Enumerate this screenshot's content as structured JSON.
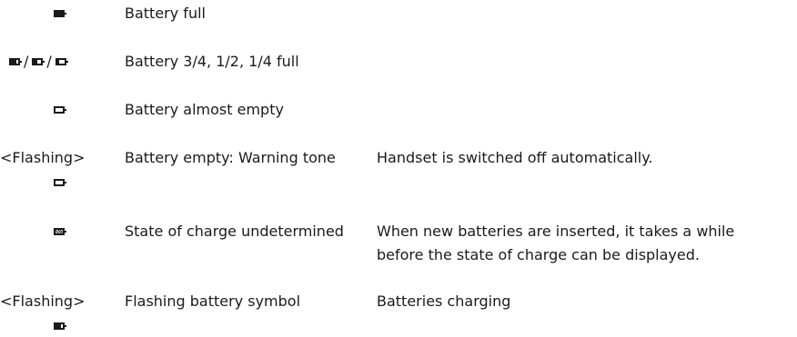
{
  "flashing_label": "<Flashing>",
  "separator": "/",
  "rows": [
    {
      "icons": [
        {
          "name": "battery-full-icon",
          "level": 1.0
        }
      ],
      "description": "Battery full",
      "note": ""
    },
    {
      "icons": [
        {
          "name": "battery-three-quarter-icon",
          "level": 0.75
        },
        {
          "name": "battery-half-icon",
          "level": 0.5
        },
        {
          "name": "battery-quarter-icon",
          "level": 0.25
        }
      ],
      "description": "Battery 3/4, 1/2, 1/4 full",
      "note": ""
    },
    {
      "icons": [
        {
          "name": "battery-almost-empty-icon",
          "level": 0.0
        }
      ],
      "description": "Battery almost empty",
      "note": ""
    },
    {
      "flashing": true,
      "icons": [
        {
          "name": "battery-empty-icon",
          "level": 0.0
        }
      ],
      "description": "Battery empty: Warning tone",
      "note_lines": [
        "Handset is switched off automatically."
      ]
    },
    {
      "icons": [
        {
          "name": "battery-undetermined-icon",
          "level": 1.0,
          "pattern": "question"
        }
      ],
      "description": "State of charge undetermined",
      "note_lines": [
        "When new batteries are inserted, it takes a while",
        "before the state of charge can be displayed."
      ]
    },
    {
      "flashing": true,
      "icons": [
        {
          "name": "battery-charging-icon",
          "level": 0.75
        }
      ],
      "description": "Flashing battery symbol",
      "note_lines": [
        "Batteries charging"
      ]
    }
  ]
}
